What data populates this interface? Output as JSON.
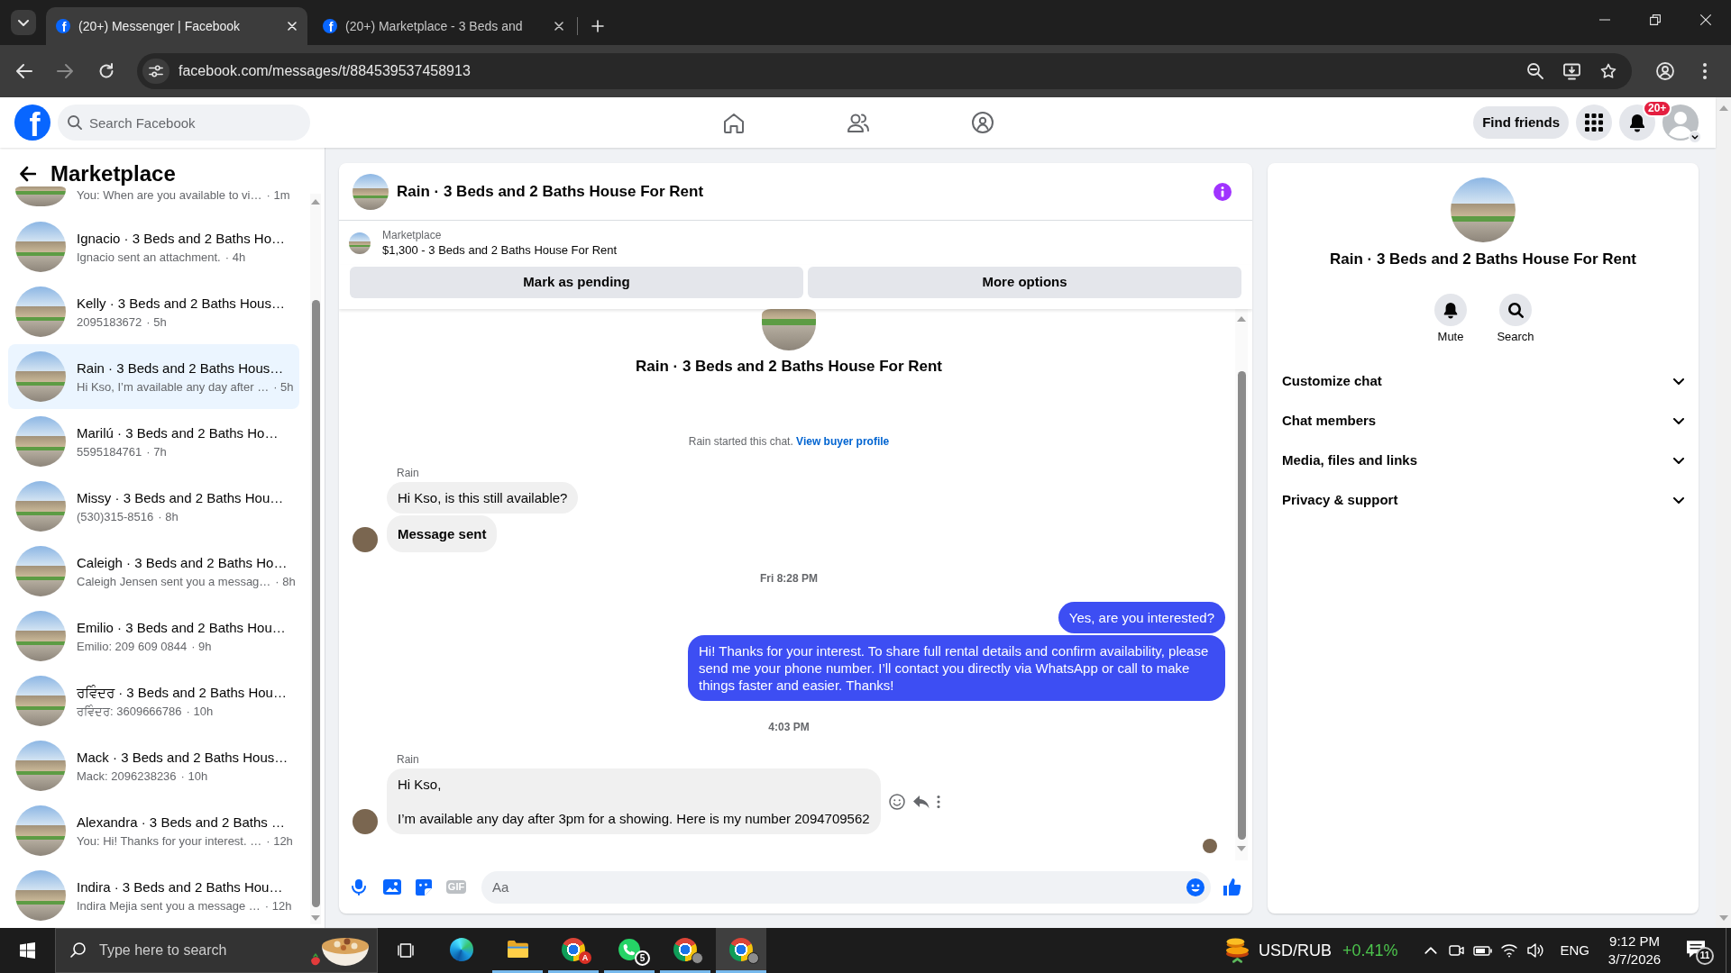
{
  "browser": {
    "tabs": [
      {
        "favicon": "f",
        "title": "(20+) Messenger | Facebook",
        "selected": true
      },
      {
        "favicon": "f",
        "title": "(20+) Marketplace - 3 Beds and",
        "selected": false
      }
    ],
    "url": "facebook.com/messages/t/884539537458913"
  },
  "header": {
    "logo": "f",
    "search_placeholder": "Search Facebook",
    "find_friends": "Find friends",
    "notification_badge": "20+"
  },
  "sidebar": {
    "title": "Marketplace",
    "scrolled_item": {
      "preview": "You: When are you available to vi…",
      "time": "· 1m"
    },
    "conversations": [
      {
        "name": "Ignacio · 3 Beds and 2 Baths Ho…",
        "preview": "Ignacio sent an attachment.",
        "time": "· 4h",
        "selected": false
      },
      {
        "name": "Kelly · 3 Beds and 2 Baths Hous…",
        "preview": "2095183672",
        "time": "· 5h",
        "selected": false
      },
      {
        "name": "Rain · 3 Beds and 2 Baths Hous…",
        "preview": "Hi Kso, I’m available any day after …",
        "time": "· 5h",
        "selected": true
      },
      {
        "name": "Marilú · 3 Beds and 2 Baths Ho…",
        "preview": "5595184761",
        "time": "· 7h",
        "selected": false
      },
      {
        "name": "Missy · 3 Beds and 2 Baths Hou…",
        "preview": "(530)315-8516",
        "time": "· 8h",
        "selected": false
      },
      {
        "name": "Caleigh · 3 Beds and 2 Baths Ho…",
        "preview": "Caleigh Jensen sent you a messag…",
        "time": "· 8h",
        "selected": false
      },
      {
        "name": "Emilio · 3 Beds and 2 Baths Hou…",
        "preview": "Emilio: 209 609 0844",
        "time": "· 9h",
        "selected": false
      },
      {
        "name": "ਰਵਿੰਦਰ · 3 Beds and 2 Baths Hou…",
        "preview": "ਰਵਿੰਦਰ: 3609666786",
        "time": "· 10h",
        "selected": false
      },
      {
        "name": "Mack · 3 Beds and 2 Baths Hous…",
        "preview": "Mack: 2096238236",
        "time": "· 10h",
        "selected": false
      },
      {
        "name": "Alexandra · 3 Beds and 2 Baths …",
        "preview": "You: Hi! Thanks for your interest. …",
        "time": "· 12h",
        "selected": false
      },
      {
        "name": "Indira · 3 Beds and 2 Baths Hou…",
        "preview": "Indira Mejia sent you a message …",
        "time": "· 12h",
        "selected": false
      }
    ]
  },
  "chat": {
    "title": "Rain · 3 Beds and 2 Baths House For Rent",
    "listing": {
      "label": "Marketplace",
      "title": "$1,300 - 3 Beds and 2 Baths House For Rent"
    },
    "actions": [
      "Mark as pending",
      "More options"
    ],
    "intro": {
      "title": "Rain · 3 Beds and 2 Baths House For Rent",
      "notice": "Rain started this chat.",
      "link": "View buyer profile"
    },
    "messages": [
      {
        "kind": "sender",
        "text": "Rain"
      },
      {
        "kind": "incoming",
        "text": "Hi Kso, is this still available?",
        "bold": false,
        "avatar": false,
        "hovered": false
      },
      {
        "kind": "incoming",
        "text": "Message sent",
        "bold": true,
        "avatar": true,
        "hovered": false
      },
      {
        "kind": "time",
        "text": "Fri 8:28 PM"
      },
      {
        "kind": "outgoing",
        "text": "Yes, are you interested?"
      },
      {
        "kind": "outgoing",
        "text": "Hi! Thanks for your interest. To share full rental details and confirm availability, please send me your phone number. I’ll contact you directly via WhatsApp or call to make things faster and easier. Thanks!"
      },
      {
        "kind": "time",
        "text": "4:03 PM"
      },
      {
        "kind": "sender",
        "text": "Rain"
      },
      {
        "kind": "incoming",
        "text": "Hi Kso,\n\nI’m available any day after 3pm for a showing. Here is my number 2094709562",
        "bold": false,
        "avatar": true,
        "hovered": true
      }
    ],
    "read_receipt": true,
    "composer": {
      "gif": "GIF",
      "placeholder": "Aa"
    }
  },
  "details": {
    "title": "Rain · 3 Beds and 2 Baths House For Rent",
    "actions": [
      {
        "kind": "mute",
        "label": "Mute"
      },
      {
        "kind": "search",
        "label": "Search"
      }
    ],
    "sections": [
      {
        "label": "Customize chat",
        "expanded": false
      },
      {
        "label": "Chat members",
        "expanded": false
      },
      {
        "label": "Media, files and links",
        "expanded": false
      },
      {
        "label": "Privacy & support",
        "expanded": false
      }
    ]
  },
  "taskbar": {
    "search_placeholder": "Type here to search",
    "apps": [
      {
        "kind": "edge",
        "running": false,
        "selected": false
      },
      {
        "kind": "folder",
        "running": true,
        "selected": false
      },
      {
        "kind": "browser",
        "badge": "A",
        "running": true,
        "selected": false
      },
      {
        "kind": "messenger",
        "badge": "5",
        "running": true,
        "selected": false
      },
      {
        "kind": "browser_profile",
        "running": true,
        "selected": false
      },
      {
        "kind": "browser_profile",
        "running": true,
        "selected": true
      }
    ],
    "ticker": {
      "symbol": "USD/RUB",
      "change": "+0.41%"
    },
    "language": "ENG",
    "time": "9:12 PM",
    "date": "3/7/2026",
    "notifications": "11"
  }
}
